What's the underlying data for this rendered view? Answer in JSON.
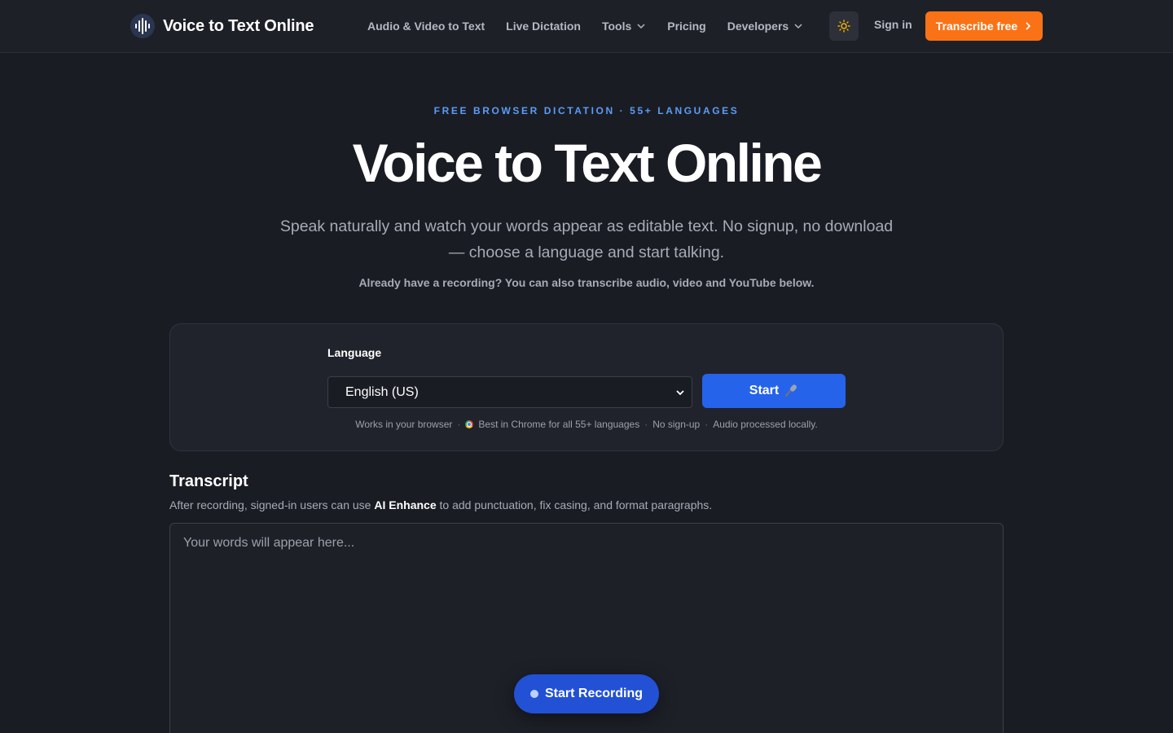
{
  "header": {
    "brand": "Voice to Text Online",
    "nav": [
      {
        "label": "Audio & Video to Text",
        "has_dropdown": false
      },
      {
        "label": "Live Dictation",
        "has_dropdown": false
      },
      {
        "label": "Tools",
        "has_dropdown": true
      },
      {
        "label": "Pricing",
        "has_dropdown": false
      },
      {
        "label": "Developers",
        "has_dropdown": true
      }
    ],
    "theme_icon": "sun-icon",
    "signin": "Sign in",
    "cta": "Transcribe free"
  },
  "hero": {
    "eyebrow": "FREE BROWSER DICTATION · 55+ LANGUAGES",
    "title": "Voice to Text Online",
    "subtitle": "Speak naturally and watch your words appear as editable text. No signup, no download — choose a language and start talking.",
    "note": "Already have a recording? You can also transcribe audio, video and YouTube below."
  },
  "dictation": {
    "language_label": "Language",
    "language_value": "English (US)",
    "start_label": "Start",
    "start_icon": "microphone-icon",
    "meta": {
      "browser": "Works in your browser",
      "chrome": "Best in Chrome for all 55+ languages",
      "signup": "No sign-up",
      "local": "Audio processed locally."
    }
  },
  "transcript": {
    "title": "Transcript",
    "desc_before": "After recording, signed-in users can use ",
    "desc_bold": "AI Enhance",
    "desc_after": " to add punctuation, fix casing, and format paragraphs.",
    "placeholder": "Your words will appear here...",
    "record_label": "Start Recording"
  },
  "colors": {
    "background": "#1a1c24",
    "accent_orange": "#f97316",
    "accent_blue": "#2563eb",
    "eyebrow_blue": "#5b9cf5"
  }
}
